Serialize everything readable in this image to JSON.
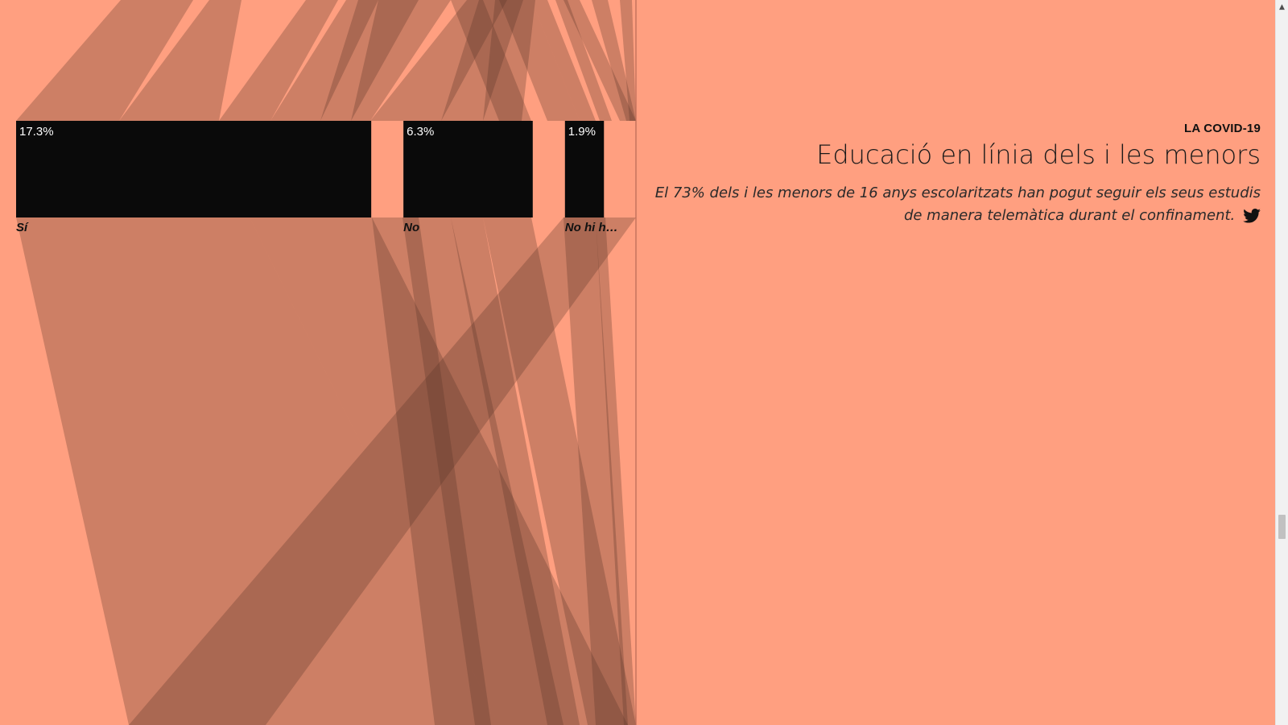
{
  "colors": {
    "background": "#ff9f80",
    "bar": "#0a0a0a",
    "flow": "#5a3528",
    "text": "#111111"
  },
  "chart_data": {
    "type": "bar",
    "categories": [
      "Sí",
      "No",
      "No hi h…"
    ],
    "values": [
      17.3,
      6.3,
      1.9
    ],
    "value_labels": [
      "17.3%",
      "6.3%",
      "1.9%"
    ],
    "value_unit": "%"
  },
  "panel": {
    "kicker": "LA COVID-19",
    "title": "Educació en línia dels i les menors",
    "description": "El 73% dels i les menors de 16 anys escolaritzats han pogut seguir els seus estudis de manera telemàtica durant el confinament."
  },
  "icons": {
    "share": "twitter-icon",
    "scroll_up": "chevron-up-icon"
  }
}
